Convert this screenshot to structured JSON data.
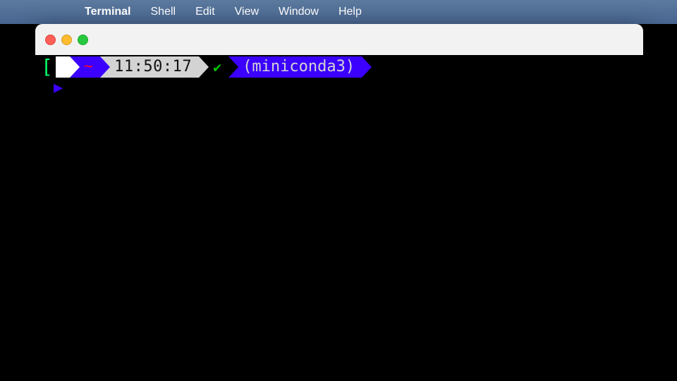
{
  "menubar": {
    "app": "Terminal",
    "items": [
      "Shell",
      "Edit",
      "View",
      "Window",
      "Help"
    ]
  },
  "window": {
    "controls": {
      "close": "close",
      "minimize": "minimize",
      "maximize": "maximize"
    }
  },
  "prompt": {
    "os_glyph": "",
    "cwd": "~",
    "time": "11:50:17",
    "status_glyph": "✔",
    "env": "(miniconda3)",
    "bracket": "[",
    "caret": "▶",
    "command": ""
  }
}
